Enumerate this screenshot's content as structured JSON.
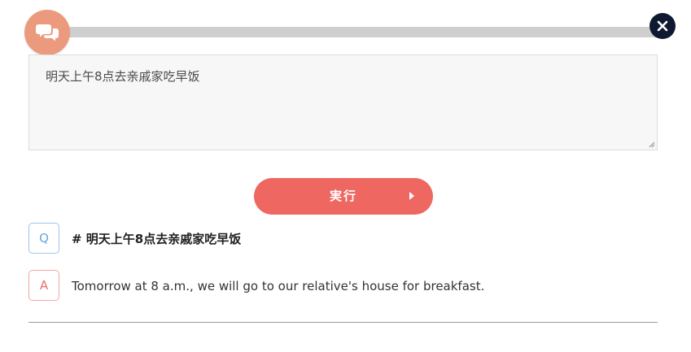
{
  "header": {
    "badge_icon": "chat-bubbles-icon",
    "close_icon": "close-icon",
    "colors": {
      "badge": "#ec9a7e",
      "close": "#0f1831",
      "track": "#cfcfcf"
    }
  },
  "input": {
    "value": "明天上午8点去亲戚家吃早饭"
  },
  "run_button": {
    "label": "実行",
    "icon": "play-arrow-icon",
    "color": "#ee6760"
  },
  "result": {
    "question": {
      "badge": "Q",
      "text": "# 明天上午8点去亲戚家吃早饭"
    },
    "answer": {
      "badge": "A",
      "text": "Tomorrow at 8 a.m., we will go to our relative's house for breakfast."
    }
  }
}
